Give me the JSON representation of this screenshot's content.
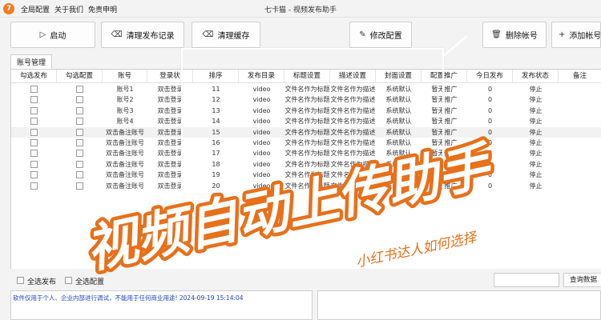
{
  "window": {
    "logo": "7",
    "title": "七卡猫 - 视频发布助手",
    "menu": [
      "全局配置",
      "关于我们",
      "免责申明"
    ]
  },
  "toolbar": {
    "start": "启动",
    "clear_records": "清理发布记录",
    "clear_cache": "清理缓存",
    "edit_config": "修改配置",
    "delete_account": "删除帐号",
    "add_account": "添加帐号"
  },
  "tab": "账号管理",
  "table": {
    "headers": [
      "勾选发布",
      "勾选配置",
      "账号",
      "登录状",
      "排序",
      "发布目录",
      "标题设置",
      "描述设置",
      "封面设置",
      "配置推广",
      "今日发布",
      "发布状态",
      "备注"
    ],
    "rows": [
      [
        "账号1",
        "双击登录",
        "11",
        "video",
        "文件名作为标题",
        "文件名作为描述",
        "系统默认",
        "暂无推广",
        "0",
        "停止",
        ""
      ],
      [
        "账号2",
        "双击登录",
        "12",
        "video",
        "文件名作为标题",
        "文件名作为描述",
        "系统默认",
        "暂无推广",
        "0",
        "停止",
        ""
      ],
      [
        "账号3",
        "双击登录",
        "13",
        "video",
        "文件名作为标题",
        "文件名作为描述",
        "系统默认",
        "暂无推广",
        "0",
        "停止",
        ""
      ],
      [
        "账号4",
        "双击登录",
        "14",
        "video",
        "文件名作为标题",
        "文件名作为描述",
        "系统默认",
        "暂无推广",
        "0",
        "停止",
        ""
      ],
      [
        "双击备注账号",
        "双击登录",
        "15",
        "video",
        "文件名作为标题",
        "文件名作为描述",
        "系统默认",
        "暂无推广",
        "0",
        "停止",
        ""
      ],
      [
        "双击备注账号",
        "双击登录",
        "16",
        "video",
        "文件名作为标题",
        "文件名作为描述",
        "系统默认",
        "暂无推广",
        "0",
        "停止",
        ""
      ],
      [
        "双击备注账号",
        "双击登录",
        "17",
        "video",
        "文件名作为标题",
        "文件名作为描述",
        "系统默认",
        "暂无推广",
        "0",
        "停止",
        ""
      ],
      [
        "双击备注账号",
        "双击登录",
        "18",
        "video",
        "文件名作为标题",
        "文件名作为描述",
        "系统默认",
        "暂无推广",
        "0",
        "停止",
        ""
      ],
      [
        "双击备注账号",
        "双击登录",
        "19",
        "video",
        "文件名作为标题",
        "文件名作为描述",
        "系统默认",
        "暂无推广",
        "0",
        "停止",
        ""
      ],
      [
        "双击备注账号",
        "双击登录",
        "20",
        "video",
        "文件名作为标题",
        "文件名作为描述",
        "系统默认",
        "暂无推广",
        "0",
        "停止",
        ""
      ]
    ]
  },
  "bottom": {
    "select_all_publish": "全选发布",
    "select_all_config": "全选配置",
    "search_value": "",
    "search_button": "查询数据"
  },
  "log": "软件仅用于个人、企业内部进行调试，不能用于任何商业用途! 2024-09-19 15:14:04",
  "overlay": {
    "headline": "视频自动上传助手",
    "subline": "小红书达人如何选择",
    "headline_fill": "#ffffff",
    "headline_stroke": "#e8701a",
    "subline_color": "#e8701a"
  }
}
